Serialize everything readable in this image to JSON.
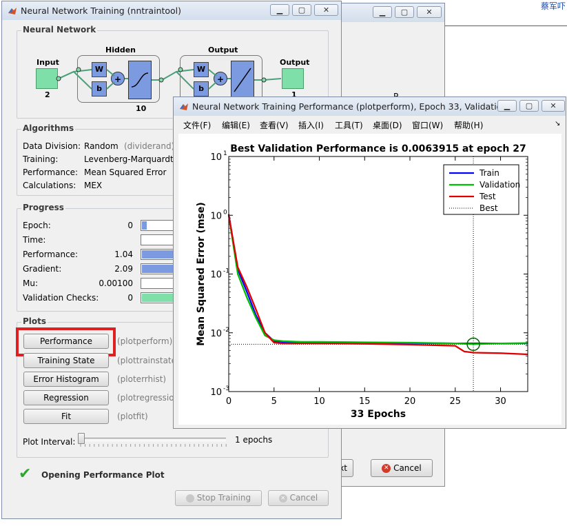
{
  "desktop": {
    "corner_text": "蔡军吓"
  },
  "back_window": {
    "dialog": {
      "next_label": "xt",
      "cancel_label": "Cancel"
    },
    "partial_label": "P"
  },
  "nntool": {
    "title": "Neural Network Training (nntraintool)",
    "network": {
      "section": "Neural Network",
      "hidden_label": "Hidden",
      "output_layer_label": "Output",
      "input_label": "Input",
      "input_size": "2",
      "output_label": "Output",
      "output_size": "1",
      "hidden_size": "10",
      "w": "W",
      "b": "b"
    },
    "algorithms": {
      "section": "Algorithms",
      "rows": [
        {
          "label": "Data Division:",
          "value": "Random",
          "fn": "(dividerand)"
        },
        {
          "label": "Training:",
          "value": "Levenberg-Marquardt",
          "fn": ""
        },
        {
          "label": "Performance:",
          "value": "Mean Squared Error",
          "fn": ""
        },
        {
          "label": "Calculations:",
          "value": "MEX",
          "fn": ""
        }
      ]
    },
    "progress": {
      "section": "Progress",
      "rows": [
        {
          "label": "Epoch:",
          "value": "0",
          "fill": 0.12,
          "color": "#7b9ae0"
        },
        {
          "label": "Time:",
          "value": "",
          "fill": 0,
          "color": "#7b9ae0"
        },
        {
          "label": "Performance:",
          "value": "1.04",
          "fill": 1.0,
          "color": "#7b9ae0"
        },
        {
          "label": "Gradient:",
          "value": "2.09",
          "fill": 1.0,
          "color": "#7b9ae0"
        },
        {
          "label": "Mu:",
          "value": "0.00100",
          "fill": 0,
          "color": "#7b9ae0"
        },
        {
          "label": "Validation Checks:",
          "value": "0",
          "fill": 1.0,
          "color": "#7ee0a8"
        }
      ]
    },
    "plots": {
      "section": "Plots",
      "buttons": [
        {
          "label": "Performance",
          "fn": "(plotperform)"
        },
        {
          "label": "Training State",
          "fn": "(plottrainstate)"
        },
        {
          "label": "Error Histogram",
          "fn": "(ploterrhist)"
        },
        {
          "label": "Regression",
          "fn": "(plotregression)"
        },
        {
          "label": "Fit",
          "fn": "(plotfit)"
        }
      ],
      "interval_label": "Plot Interval:",
      "interval_value": "1 epochs",
      "interval_fill": 0.0
    },
    "status": "Opening Performance Plot",
    "stop_label": "Stop Training",
    "cancel_label": "Cancel"
  },
  "plot_window": {
    "title": "Neural Network Training Performance (plotperform), Epoch 33, Validatio...",
    "menu": [
      "文件(F)",
      "编辑(E)",
      "查看(V)",
      "插入(I)",
      "工具(T)",
      "桌面(D)",
      "窗口(W)",
      "帮助(H)"
    ]
  },
  "chart_data": {
    "type": "line",
    "title": "Best Validation Performance is 0.0063915 at epoch 27",
    "xlabel": "33 Epochs",
    "ylabel": "Mean Squared Error  (mse)",
    "xlim": [
      0,
      33
    ],
    "ylim": [
      0.001,
      10
    ],
    "yscale": "log",
    "xticks": [
      0,
      5,
      10,
      15,
      20,
      25,
      30
    ],
    "yticks": [
      {
        "base": "10",
        "exp": "1",
        "v": 10
      },
      {
        "base": "10",
        "exp": "0",
        "v": 1
      },
      {
        "base": "10",
        "exp": "-1",
        "v": 0.1
      },
      {
        "base": "10",
        "exp": "-2",
        "v": 0.01
      },
      {
        "base": "10",
        "exp": "-3",
        "v": 0.001
      }
    ],
    "legend_position": "top-right",
    "series": [
      {
        "name": "Train",
        "color": "#0000ff",
        "x": [
          0,
          1,
          2,
          3,
          4,
          5,
          6,
          7,
          8,
          10,
          15,
          20,
          25,
          27,
          30,
          33
        ],
        "y": [
          1.04,
          0.12,
          0.05,
          0.02,
          0.01,
          0.0072,
          0.007,
          0.0069,
          0.0069,
          0.0069,
          0.0068,
          0.0067,
          0.0066,
          0.0066,
          0.0066,
          0.0066
        ]
      },
      {
        "name": "Validation",
        "color": "#00c000",
        "x": [
          0,
          1,
          2,
          3,
          4,
          5,
          6,
          7,
          8,
          10,
          15,
          20,
          25,
          27,
          30,
          33
        ],
        "y": [
          1.0,
          0.1,
          0.04,
          0.018,
          0.009,
          0.0075,
          0.0072,
          0.0071,
          0.007,
          0.007,
          0.0069,
          0.0068,
          0.0066,
          0.0063915,
          0.0066,
          0.0067
        ]
      },
      {
        "name": "Test",
        "color": "#e00000",
        "x": [
          0,
          1,
          2,
          3,
          4,
          5,
          6,
          7,
          8,
          10,
          15,
          20,
          25,
          26,
          27,
          30,
          33
        ],
        "y": [
          1.0,
          0.13,
          0.06,
          0.025,
          0.01,
          0.0068,
          0.0066,
          0.0066,
          0.0066,
          0.0066,
          0.0065,
          0.0063,
          0.006,
          0.0048,
          0.0046,
          0.0045,
          0.0043
        ]
      }
    ],
    "best": {
      "name": "Best",
      "epoch": 27,
      "value": 0.0063915,
      "goal_line": 0.0063915
    }
  }
}
